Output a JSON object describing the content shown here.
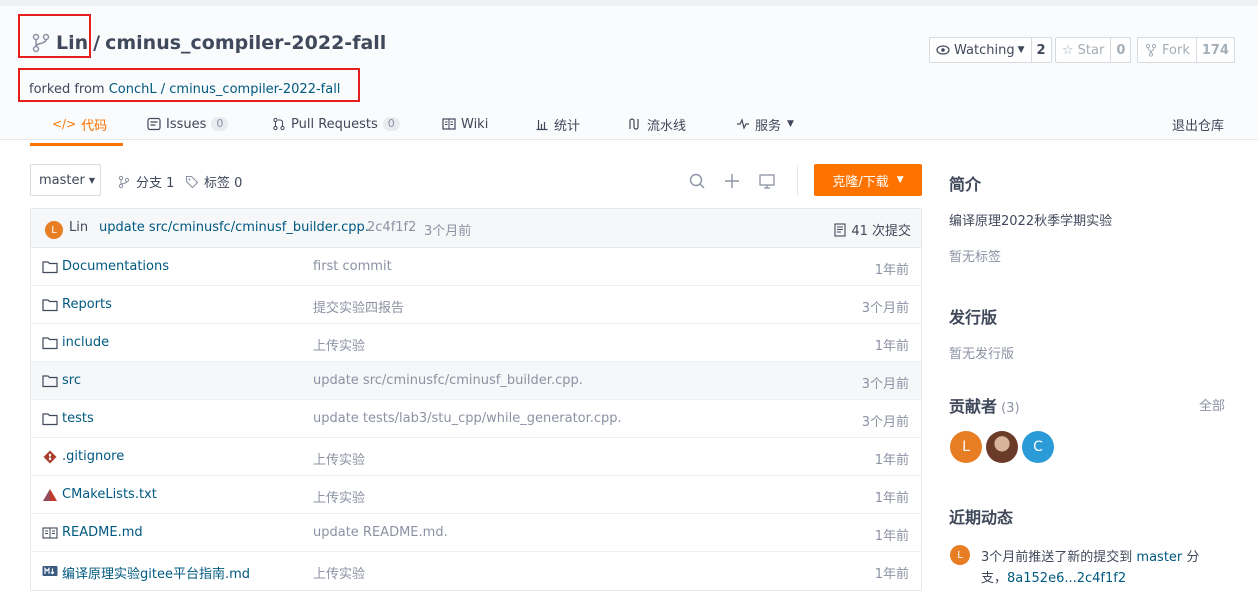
{
  "repo": {
    "owner": "Lin",
    "separator": "/",
    "name": "cminus_compiler-2022-fall",
    "forked_prefix": "forked from",
    "forked_source": "ConchL / cminus_compiler-2022-fall"
  },
  "actions": {
    "watch_label": "Watching",
    "watch_count": "2",
    "star_label": "Star",
    "star_count": "0",
    "fork_label": "Fork",
    "fork_count": "174"
  },
  "tabs": [
    {
      "label": "代码"
    },
    {
      "label": "Issues",
      "badge": "0"
    },
    {
      "label": "Pull Requests",
      "badge": "0"
    },
    {
      "label": "Wiki"
    },
    {
      "label": "统计"
    },
    {
      "label": "流水线"
    },
    {
      "label": "服务"
    }
  ],
  "exit_repo": "退出仓库",
  "toolbar": {
    "branch": "master",
    "branches": "分支 1",
    "tags": "标签 0",
    "clone": "克隆/下载"
  },
  "last_commit": {
    "avatar": "L",
    "author": "Lin",
    "message": "update src/cminusfc/cminusf_builder.cpp.",
    "sha": "2c4f1f2",
    "time": "3个月前",
    "count": "41 次提交"
  },
  "files": [
    {
      "type": "folder",
      "name": "Documentations",
      "message": "first commit",
      "time": "1年前"
    },
    {
      "type": "folder",
      "name": "Reports",
      "message": "提交实验四报告",
      "time": "3个月前"
    },
    {
      "type": "folder",
      "name": "include",
      "message": "上传实验",
      "time": "1年前"
    },
    {
      "type": "folder",
      "name": "src",
      "message": "update src/cminusfc/cminusf_builder.cpp.",
      "time": "3个月前"
    },
    {
      "type": "folder",
      "name": "tests",
      "message": "update tests/lab3/stu_cpp/while_generator.cpp.",
      "time": "3个月前"
    },
    {
      "type": "git",
      "name": ".gitignore",
      "message": "上传实验",
      "time": "1年前"
    },
    {
      "type": "cmake",
      "name": "CMakeLists.txt",
      "message": "上传实验",
      "time": "1年前"
    },
    {
      "type": "readme",
      "name": "README.md",
      "message": "update README.md.",
      "time": "1年前"
    },
    {
      "type": "markdown",
      "name": "编译原理实验gitee平台指南.md",
      "message": "上传实验",
      "time": "1年前"
    }
  ],
  "sidebar": {
    "intro_title": "简介",
    "intro_desc": "编译原理2022秋季学期实验",
    "no_tags": "暂无标签",
    "release_title": "发行版",
    "no_release": "暂无发行版",
    "contrib_title": "贡献者",
    "contrib_count": "(3)",
    "contrib_all": "全部",
    "contributors": [
      "L",
      "",
      "C"
    ],
    "activity_title": "近期动态",
    "activity_avatar": "L",
    "activity_text_1": "3个月前推送了新的提交到",
    "activity_branch": "master",
    "activity_text_2": "分",
    "activity_text_3": "支，",
    "activity_range": "8a152e6...2c4f1f2"
  },
  "colors": {
    "accent": "#fe7300",
    "link": "#005980",
    "highlight_box": "#e3201d"
  }
}
